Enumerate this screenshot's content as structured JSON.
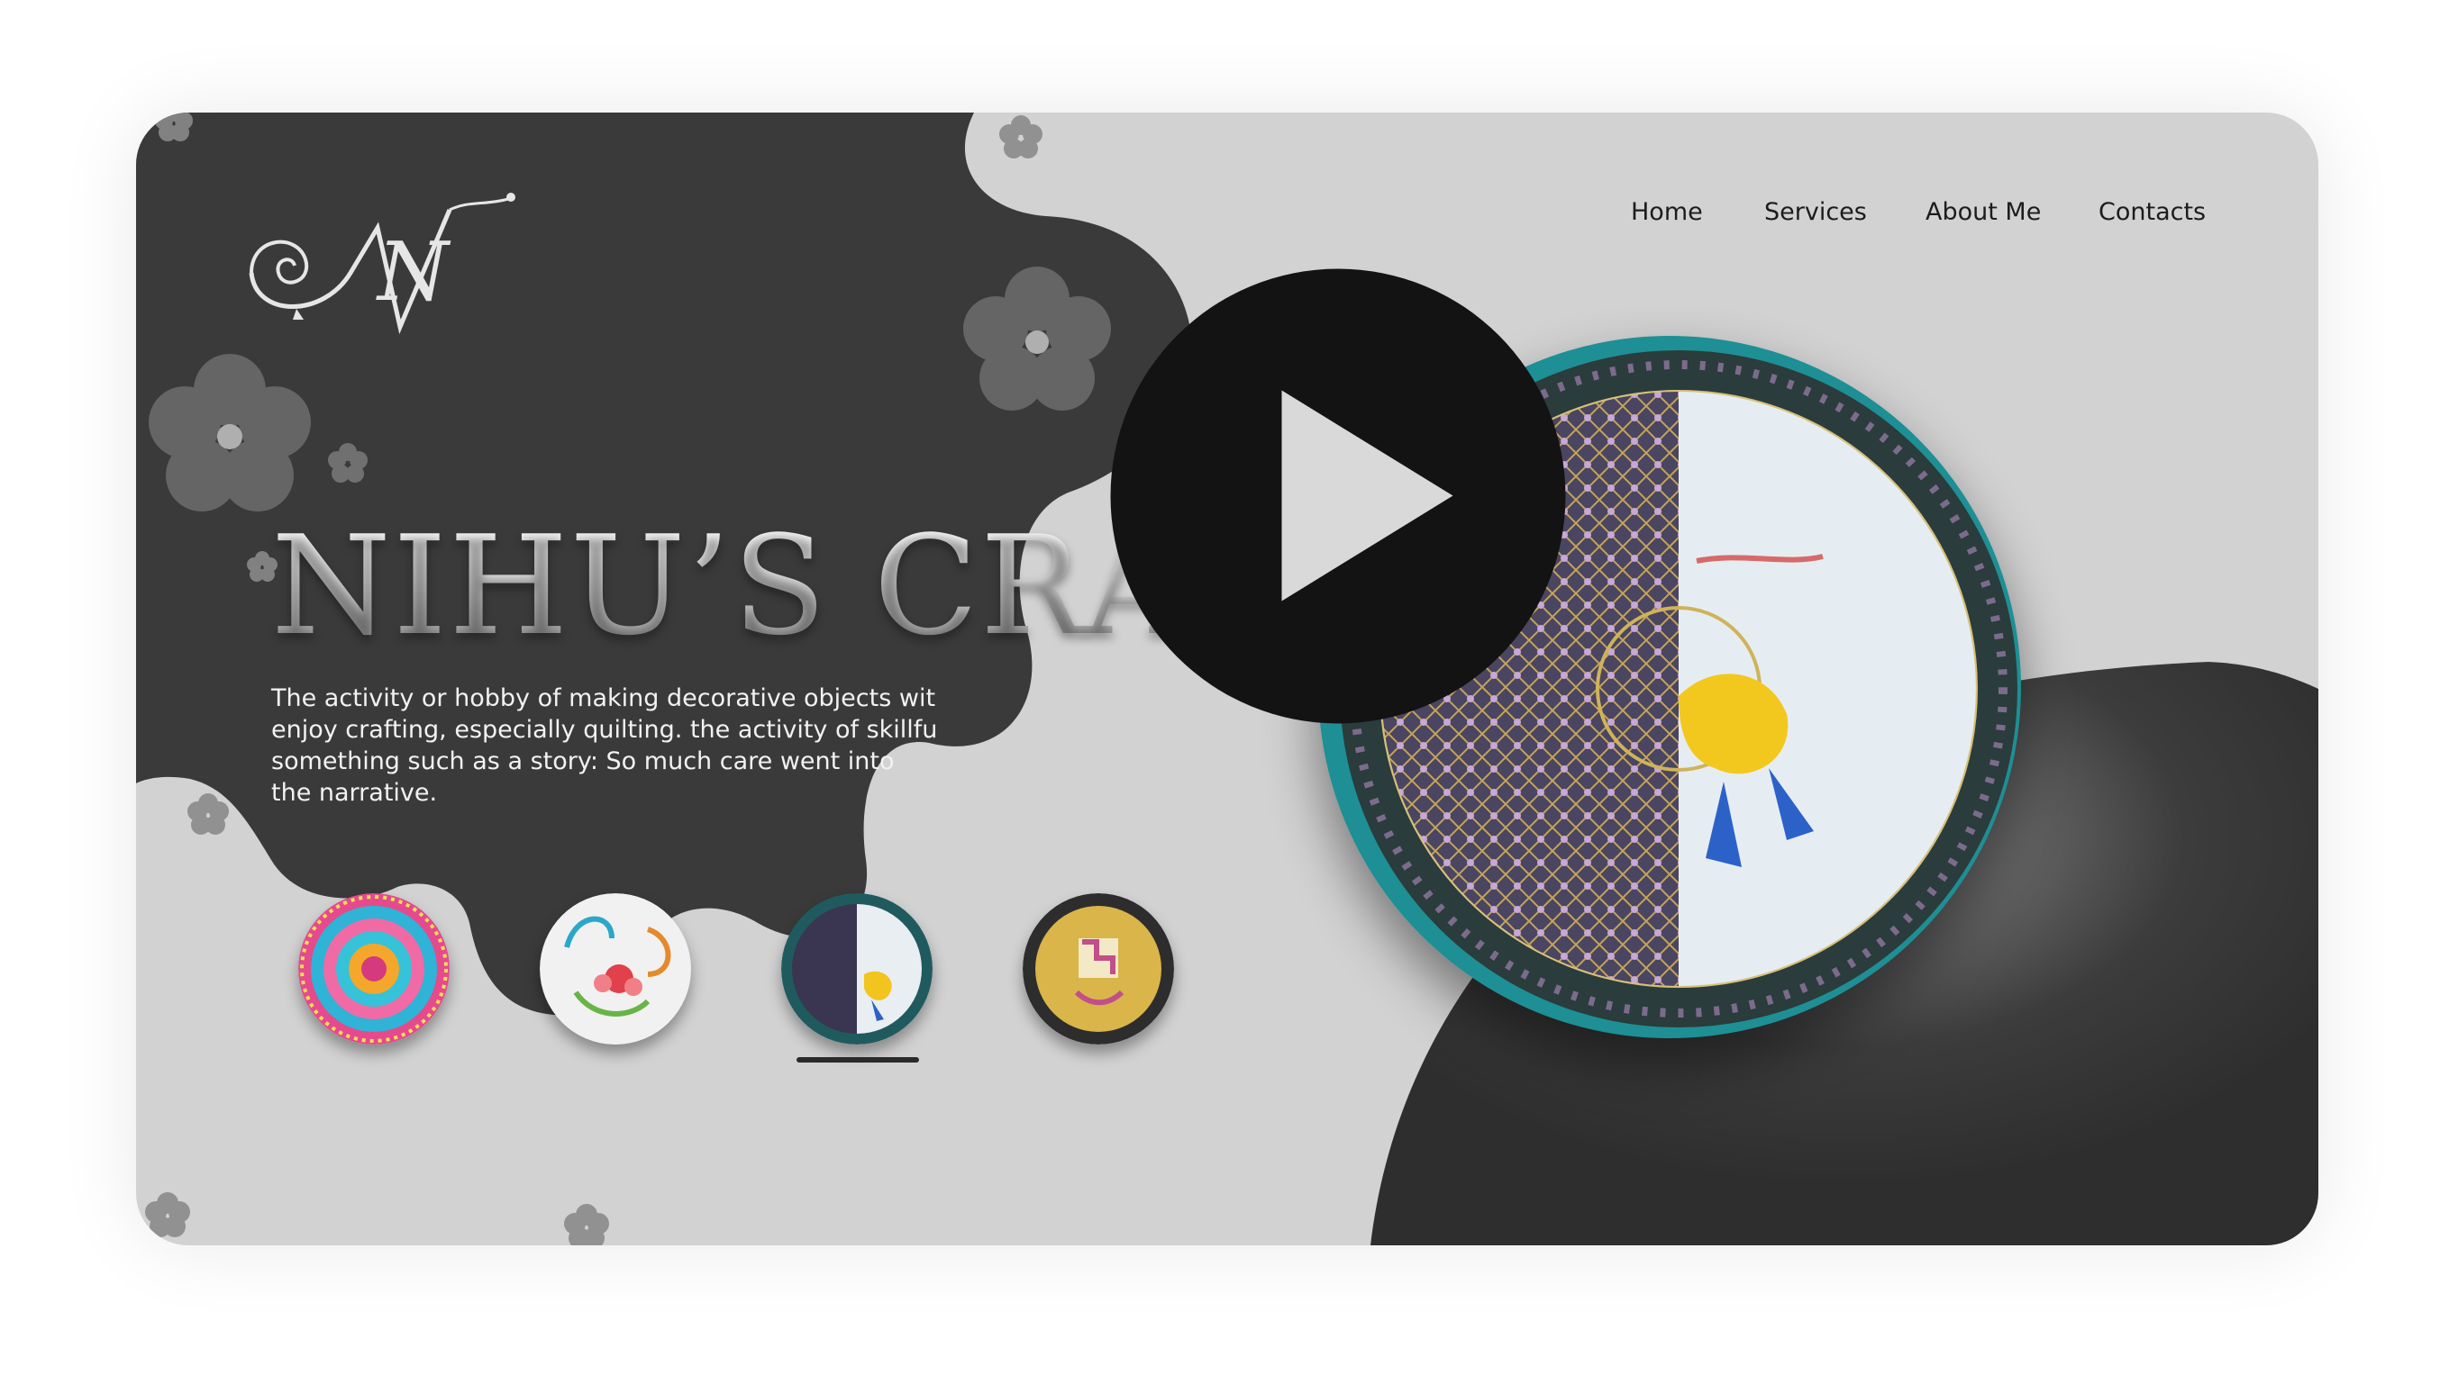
{
  "nav": {
    "items": [
      {
        "label": "Home"
      },
      {
        "label": "Services"
      },
      {
        "label": "About Me"
      },
      {
        "label": "Contacts"
      }
    ]
  },
  "hero": {
    "title": "NIHU’S CRA",
    "description": "The activity or hobby of making decorative objects wit enjoy crafting, especially quilting. the activity of skillfu something such as a story: So much care went into the narrative."
  },
  "gallery": {
    "thumbnails": [
      {
        "name": "mandala-plate"
      },
      {
        "name": "quilling-flower-plate"
      },
      {
        "name": "krishna-feet-plate"
      },
      {
        "name": "swastik-plate"
      }
    ],
    "selected_index": 2
  },
  "logo_letter": "N",
  "colors": {
    "background": "#d2d2d2",
    "dark_blob": "#3a3a3a",
    "play_button": "#131313"
  },
  "icons": [
    "play-icon",
    "flower-icon"
  ]
}
